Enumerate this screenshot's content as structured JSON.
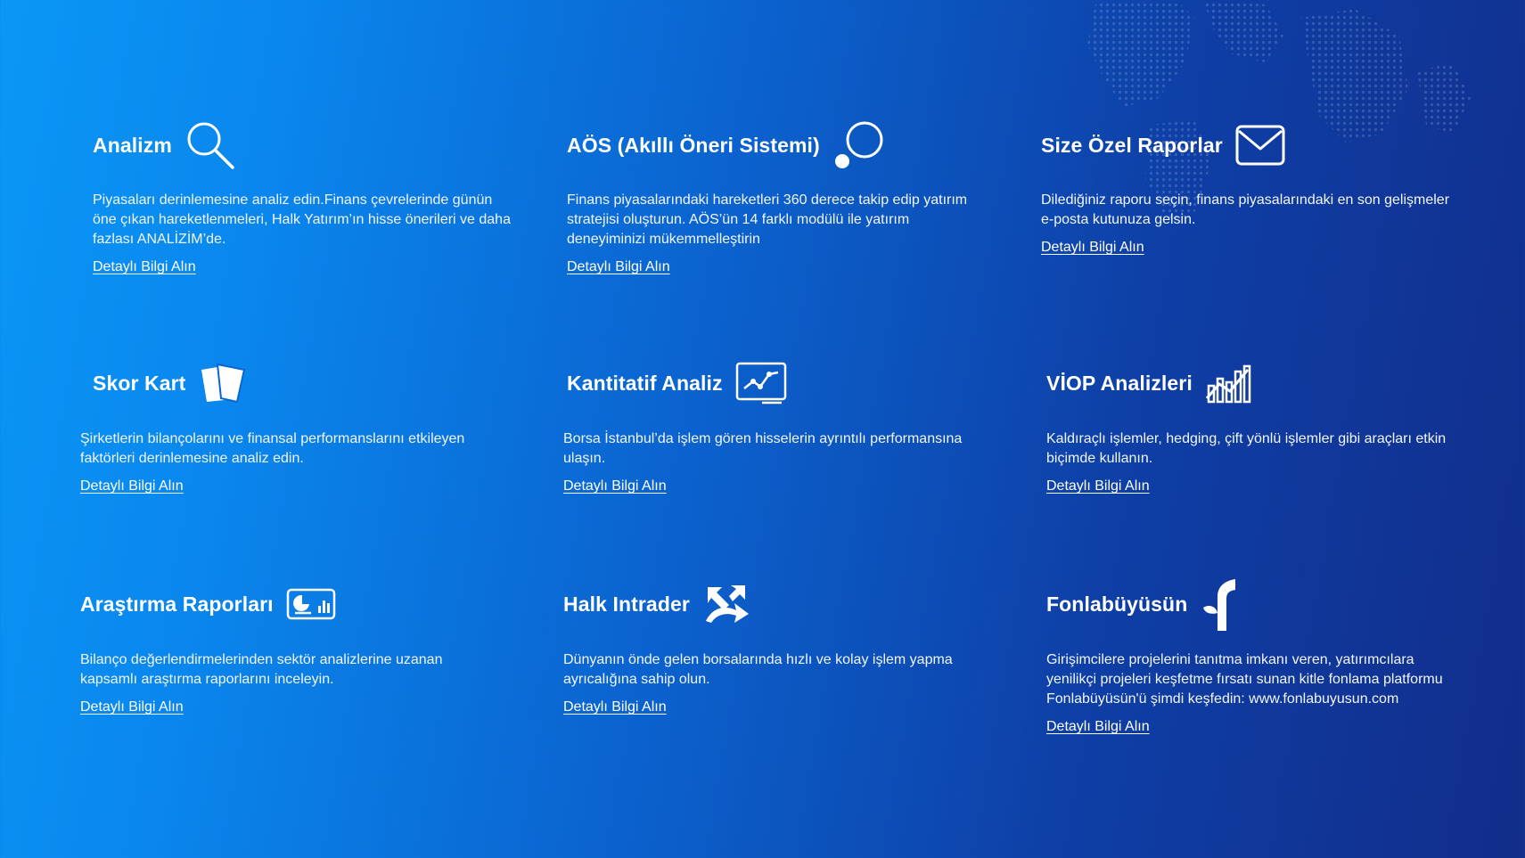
{
  "features": [
    {
      "title": "Analizm",
      "icon": "magnifier-icon",
      "description": "Piyasaları derinlemesine analiz edin.Finans çevrelerinde günün öne çıkan hareketlenmeleri, Halk Yatırım’ın hisse önerileri ve daha fazlası ANALİZİM’de.",
      "link": "Detaylı Bilgi Alın"
    },
    {
      "title": "AÖS (Akıllı Öneri Sistemi)",
      "icon": "smart-suggestion-icon",
      "description": "Finans piyasalarındaki hareketleri 360 derece takip edip yatırım stratejisi oluşturun. AÖS’ün 14 farklı modülü ile yatırım deneyiminizi mükemmelleştirin",
      "link": "Detaylı Bilgi Alın"
    },
    {
      "title": "Size Özel Raporlar",
      "icon": "envelope-icon",
      "description": "Dilediğiniz raporu seçin, finans piyasalarındaki en son gelişmeler e-posta kutunuza gelsin.",
      "link": "Detaylı Bilgi Alın"
    },
    {
      "title": "Skor Kart",
      "icon": "score-cards-icon",
      "description": "Şirketlerin bilançolarını ve finansal performanslarını etkileyen faktörleri derinlemesine analiz edin.",
      "link": "Detaylı Bilgi Alın"
    },
    {
      "title": "Kantitatif Analiz",
      "icon": "line-chart-icon",
      "description": "Borsa İstanbul’da işlem gören hisselerin ayrıntılı performansına ulaşın.",
      "link": "Detaylı Bilgi Alın"
    },
    {
      "title": "VİOP Analizleri",
      "icon": "bar-growth-icon",
      "description": "Kaldıraçlı işlemler, hedging, çift yönlü işlemler gibi araçları etkin biçimde kullanın.",
      "link": "Detaylı Bilgi Alın"
    },
    {
      "title": "Araştırma Raporları",
      "icon": "report-dashboard-icon",
      "description": "Bilanço değerlendirmelerinden sektör analizlerine uzanan kapsamlı araştırma raporlarını inceleyin.",
      "link": "Detaylı Bilgi Alın"
    },
    {
      "title": "Halk Intrader",
      "icon": "trade-arrows-icon",
      "description": "Dünyanın önde gelen borsalarında hızlı ve kolay işlem yapma ayrıcalığına sahip olun.",
      "link": "Detaylı Bilgi Alın"
    },
    {
      "title": "Fonlabüyüsün",
      "icon": "fonlabuyusun-logo-icon",
      "description": "Girişimcilere projelerini tanıtma imkanı veren, yatırımcılara yenilikçi projeleri keşfetme fırsatı sunan kitle fonlama platformu Fonlabüyüsün'ü şimdi keşfedin: www.fonlabuyusun.com",
      "link": "Detaylı Bilgi Alın"
    }
  ]
}
